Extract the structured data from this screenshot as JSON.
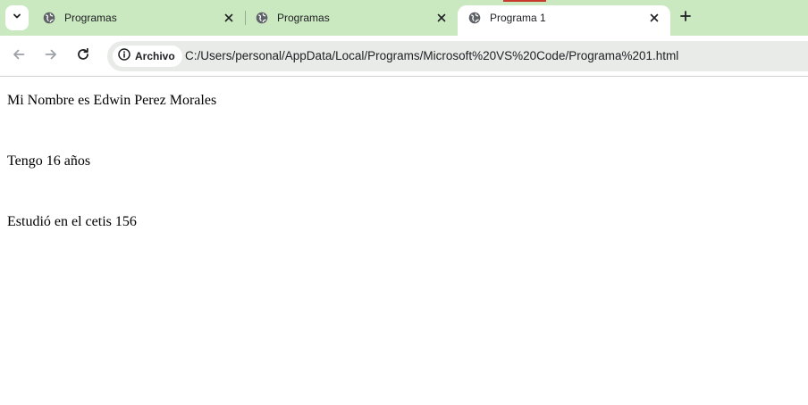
{
  "browser": {
    "tabs": [
      {
        "title": "Programas",
        "favicon": "globe-icon",
        "active": false
      },
      {
        "title": "Programas",
        "favicon": "globe-icon",
        "active": false
      },
      {
        "title": "Programa 1",
        "favicon": "globe-icon",
        "active": true
      }
    ],
    "new_tab_icon": "plus-icon",
    "tab_search_icon": "chevron-down-icon",
    "colors": {
      "tabstrip": "#cae9c0",
      "active_tab": "#ffffff",
      "omnibox": "#e9ebe9"
    }
  },
  "toolbar": {
    "back_icon": "arrow-left-icon",
    "forward_icon": "arrow-right-icon",
    "reload_icon": "reload-icon",
    "site_chip_label": "Archivo",
    "url": "C:/Users/personal/AppData/Local/Programs/Microsoft%20VS%20Code/Programa%201.html"
  },
  "page": {
    "lines": [
      "Mi Nombre es Edwin Perez Morales",
      "Tengo 16 años",
      "Estudió en el cetis 156"
    ]
  }
}
